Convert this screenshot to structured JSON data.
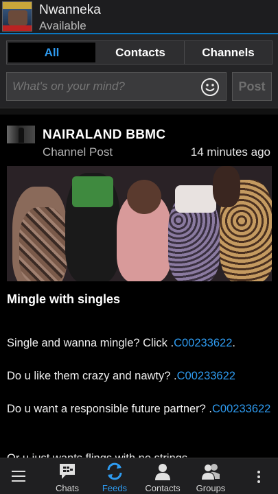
{
  "header": {
    "name": "Nwanneka",
    "status": "Available"
  },
  "tabs": [
    {
      "label": "All",
      "active": true
    },
    {
      "label": "Contacts",
      "active": false
    },
    {
      "label": "Channels",
      "active": false
    }
  ],
  "composer": {
    "placeholder": "What's on your mind?",
    "post_label": "Post"
  },
  "post": {
    "channel_name": "NAIRALAND BBMC",
    "type": "Channel Post",
    "time": "14 minutes ago",
    "title": "Mingle with singles",
    "paragraphs": [
      {
        "text": "Single and wanna mingle? Click .",
        "link": "C00233622",
        "suffix": "."
      },
      {
        "text": "Do u like them crazy and nawty? .",
        "link": "C00233622",
        "suffix": ""
      },
      {
        "text": "Do u want a responsible future partner? .",
        "link": "C00233622",
        "suffix": ""
      },
      {
        "text": "Or u just wants flings with no strings",
        "link": "",
        "suffix": ""
      }
    ]
  },
  "bottom_nav": {
    "items": [
      {
        "label": "Chats",
        "icon": "chat-icon"
      },
      {
        "label": "Feeds",
        "icon": "feeds-icon",
        "active": true
      },
      {
        "label": "Contacts",
        "icon": "contacts-icon"
      },
      {
        "label": "Groups",
        "icon": "groups-icon"
      }
    ]
  },
  "colors": {
    "accent": "#2e9bf0",
    "header_line": "#0a78c2",
    "background": "#000000"
  }
}
